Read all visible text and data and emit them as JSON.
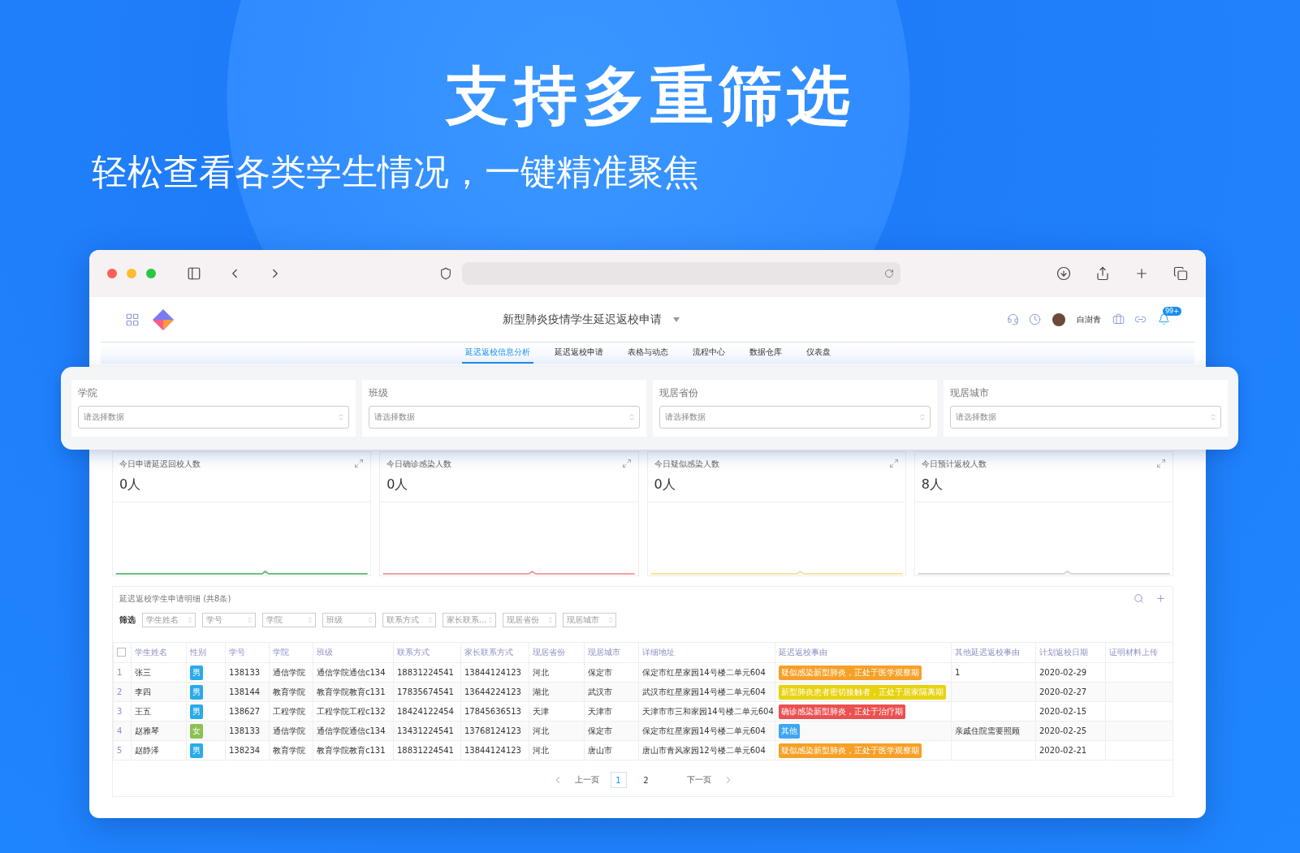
{
  "headline": "支持多重筛选",
  "subtitle": "轻松查看各类学生情况，一键精准聚焦",
  "app": {
    "title": "新型肺炎疫情学生延迟返校申请",
    "user": "白澍青",
    "badge": "99+"
  },
  "tabs": [
    {
      "label": "延迟返校信息分析",
      "selected": true
    },
    {
      "label": "延迟返校申请",
      "selected": false
    },
    {
      "label": "表格与动态",
      "selected": false
    },
    {
      "label": "流程中心",
      "selected": false
    },
    {
      "label": "数据仓库",
      "selected": false
    },
    {
      "label": "仪表盘",
      "selected": false
    }
  ],
  "filters": [
    {
      "label": "学院",
      "placeholder": "请选择数据"
    },
    {
      "label": "班级",
      "placeholder": "请选择数据"
    },
    {
      "label": "现居省份",
      "placeholder": "请选择数据"
    },
    {
      "label": "现居城市",
      "placeholder": "请选择数据"
    }
  ],
  "stats": [
    {
      "title": "今日申请延迟回校人数",
      "value": "0人",
      "color": "#6cbf7f"
    },
    {
      "title": "今日确诊感染人数",
      "value": "0人",
      "color": "#f0a0a0"
    },
    {
      "title": "今日疑似感染人数",
      "value": "0人",
      "color": "#f2e6a0"
    },
    {
      "title": "今日预计返校人数",
      "value": "8人",
      "color": "#d8d8d8"
    }
  ],
  "table": {
    "title": "延迟返校学生申请明细 (共8条)",
    "filter_label": "筛选",
    "filter_fields": [
      "学生姓名",
      "学号",
      "学院",
      "班级",
      "联系方式",
      "家长联系...",
      "现居省份",
      "现居城市"
    ],
    "select_all_checked": false,
    "columns": [
      "学生姓名",
      "性别",
      "学号",
      "学院",
      "班级",
      "联系方式",
      "家长联系方式",
      "现居省份",
      "现居城市",
      "详细地址",
      "延迟返校事由",
      "其他延迟返校事由",
      "计划返校日期",
      "证明材料上传"
    ],
    "rows": [
      {
        "index": "1",
        "name": "张三",
        "gender": {
          "text": "男",
          "color": "#2aabea"
        },
        "id": "138133",
        "college": "通信学院",
        "class": "通信学院通信c134",
        "phone": "18831224541",
        "parent_phone": "13844124123",
        "province": "河北",
        "city": "保定市",
        "address": "保定市红星家园14号楼二单元604",
        "reason": {
          "text": "疑似感染新型肺炎，正处于医学观察期",
          "color": "#f7a028"
        },
        "other_reason": "1",
        "date": "2020-02-29"
      },
      {
        "index": "2",
        "name": "李四",
        "gender": {
          "text": "男",
          "color": "#2aabea"
        },
        "id": "138144",
        "college": "教育学院",
        "class": "教育学院教育c131",
        "phone": "17835674541",
        "parent_phone": "13644224123",
        "province": "湖北",
        "city": "武汉市",
        "address": "武汉市红星家园14号楼二单元604",
        "reason": {
          "text": "新型肺炎患者密切接触者，正处于居家隔离期",
          "color": "#e8d20c"
        },
        "other_reason": "",
        "date": "2020-02-27"
      },
      {
        "index": "3",
        "name": "王五",
        "gender": {
          "text": "男",
          "color": "#2aabea"
        },
        "id": "138627",
        "college": "工程学院",
        "class": "工程学院工程c132",
        "phone": "18424122454",
        "parent_phone": "17845636513",
        "province": "天津",
        "city": "天津市",
        "address": "天津市市三和家园14号楼二单元604",
        "reason": {
          "text": "确诊感染新型肺炎，正处于治疗期",
          "color": "#ec5050"
        },
        "other_reason": "",
        "date": "2020-02-15"
      },
      {
        "index": "4",
        "name": "赵雅琴",
        "gender": {
          "text": "女",
          "color": "#8cc152"
        },
        "id": "138133",
        "college": "通信学院",
        "class": "通信学院通信c134",
        "phone": "13431224541",
        "parent_phone": "13768124123",
        "province": "河北",
        "city": "保定市",
        "address": "保定市红星家园14号楼二单元604",
        "reason": {
          "text": "其他",
          "color": "#3ea6f2"
        },
        "other_reason": "亲戚住院需要照顾",
        "date": "2020-02-25"
      },
      {
        "index": "5",
        "name": "赵静泽",
        "gender": {
          "text": "男",
          "color": "#2aabea"
        },
        "id": "138234",
        "college": "教育学院",
        "class": "教育学院教育c131",
        "phone": "18831224541",
        "parent_phone": "13844124123",
        "province": "河北",
        "city": "唐山市",
        "address": "唐山市青风家园12号楼二单元604",
        "reason": {
          "text": "疑似感染新型肺炎，正处于医学观察期",
          "color": "#f7a028"
        },
        "other_reason": "",
        "date": "2020-02-21"
      }
    ]
  },
  "pagination": {
    "prev": "上一页",
    "next": "下一页",
    "pages": [
      {
        "label": "1",
        "selected": true
      },
      {
        "label": "2",
        "selected": false
      }
    ]
  }
}
